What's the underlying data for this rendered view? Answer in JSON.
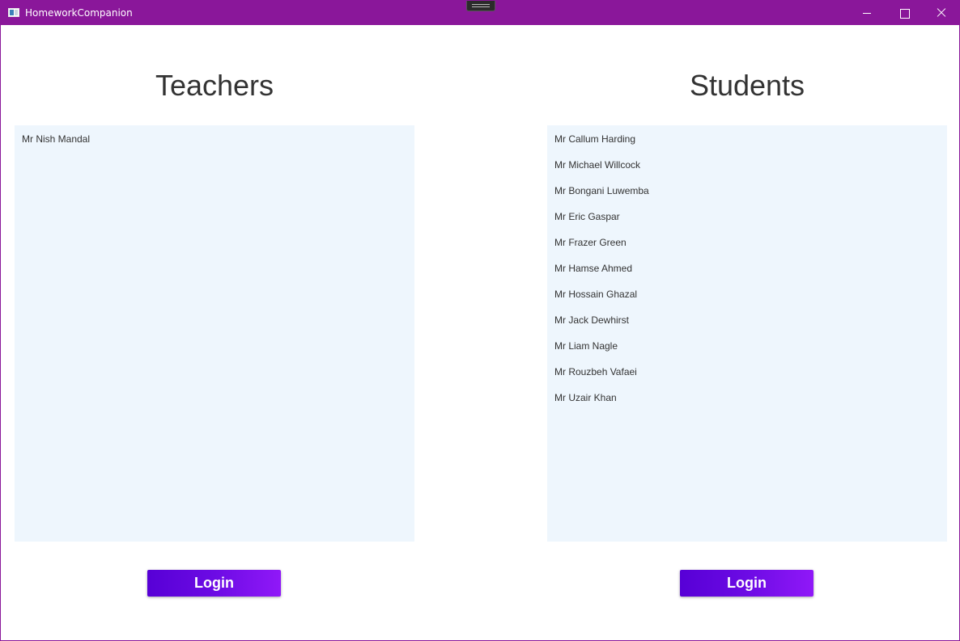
{
  "window": {
    "title": "HomeworkCompanion",
    "icons": {
      "app": "app-icon",
      "minimize": "minimize-icon",
      "maximize": "maximize-icon",
      "close": "close-icon"
    },
    "accent": "#8a179a"
  },
  "teachers": {
    "heading": "Teachers",
    "items": [
      "Mr Nish Mandal"
    ],
    "login_label": "Login"
  },
  "students": {
    "heading": "Students",
    "items": [
      "Mr Callum Harding",
      "Mr Michael Willcock",
      "Mr Bongani Luwemba",
      "Mr Eric Gaspar",
      "Mr Frazer Green",
      "Mr Hamse Ahmed",
      "Mr Hossain Ghazal",
      "Mr Jack Dewhirst",
      "Mr Liam Nagle",
      "Mr Rouzbeh Vafaei",
      "Mr Uzair Khan"
    ],
    "login_label": "Login"
  },
  "colors": {
    "list_background": "#eef6fd",
    "button_gradient_start": "#5700d6",
    "button_gradient_end": "#9018f8",
    "text": "#333333"
  }
}
